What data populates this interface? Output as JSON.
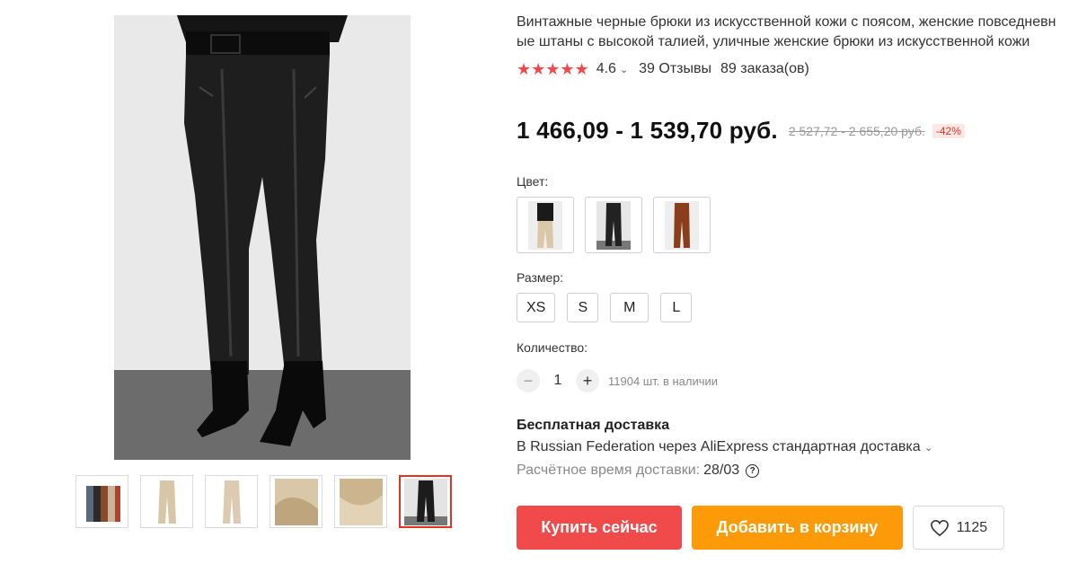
{
  "product": {
    "title": "Винтажные черные брюки из искусственной кожи с поясом, женские повседневные штаны с высокой талией, уличные женские брюки из искусственной кожи",
    "rating": "4.6",
    "reviews": "39 Отзывы",
    "orders": "89 заказа(ов)",
    "stars": "★★★★★"
  },
  "price": {
    "current": "1 466,09 - 1 539,70 руб.",
    "old": "2 527,72 - 2 655,20 руб.",
    "discount": "-42%"
  },
  "color": {
    "label": "Цвет:",
    "options": [
      "beige-with-black-top",
      "black",
      "brown"
    ]
  },
  "size": {
    "label": "Размер:",
    "options": [
      "XS",
      "S",
      "M",
      "L"
    ]
  },
  "quantity": {
    "label": "Количество:",
    "minus": "−",
    "value": "1",
    "plus": "+",
    "stock": "11904 шт. в наличии"
  },
  "shipping": {
    "title": "Бесплатная доставка",
    "line": "В Russian Federation через AliExpress стандартная доставка",
    "chevron": "⌄",
    "eta_label": "Расчётное время доставки:",
    "eta_value": "28/03",
    "help": "?"
  },
  "actions": {
    "buy": "Купить сейчас",
    "cart": "Добавить в корзину",
    "wishlist_count": "1125"
  },
  "colors": {
    "accent_red": "#f04a4a",
    "accent_orange": "#fd9a07",
    "star": "#f44848"
  }
}
